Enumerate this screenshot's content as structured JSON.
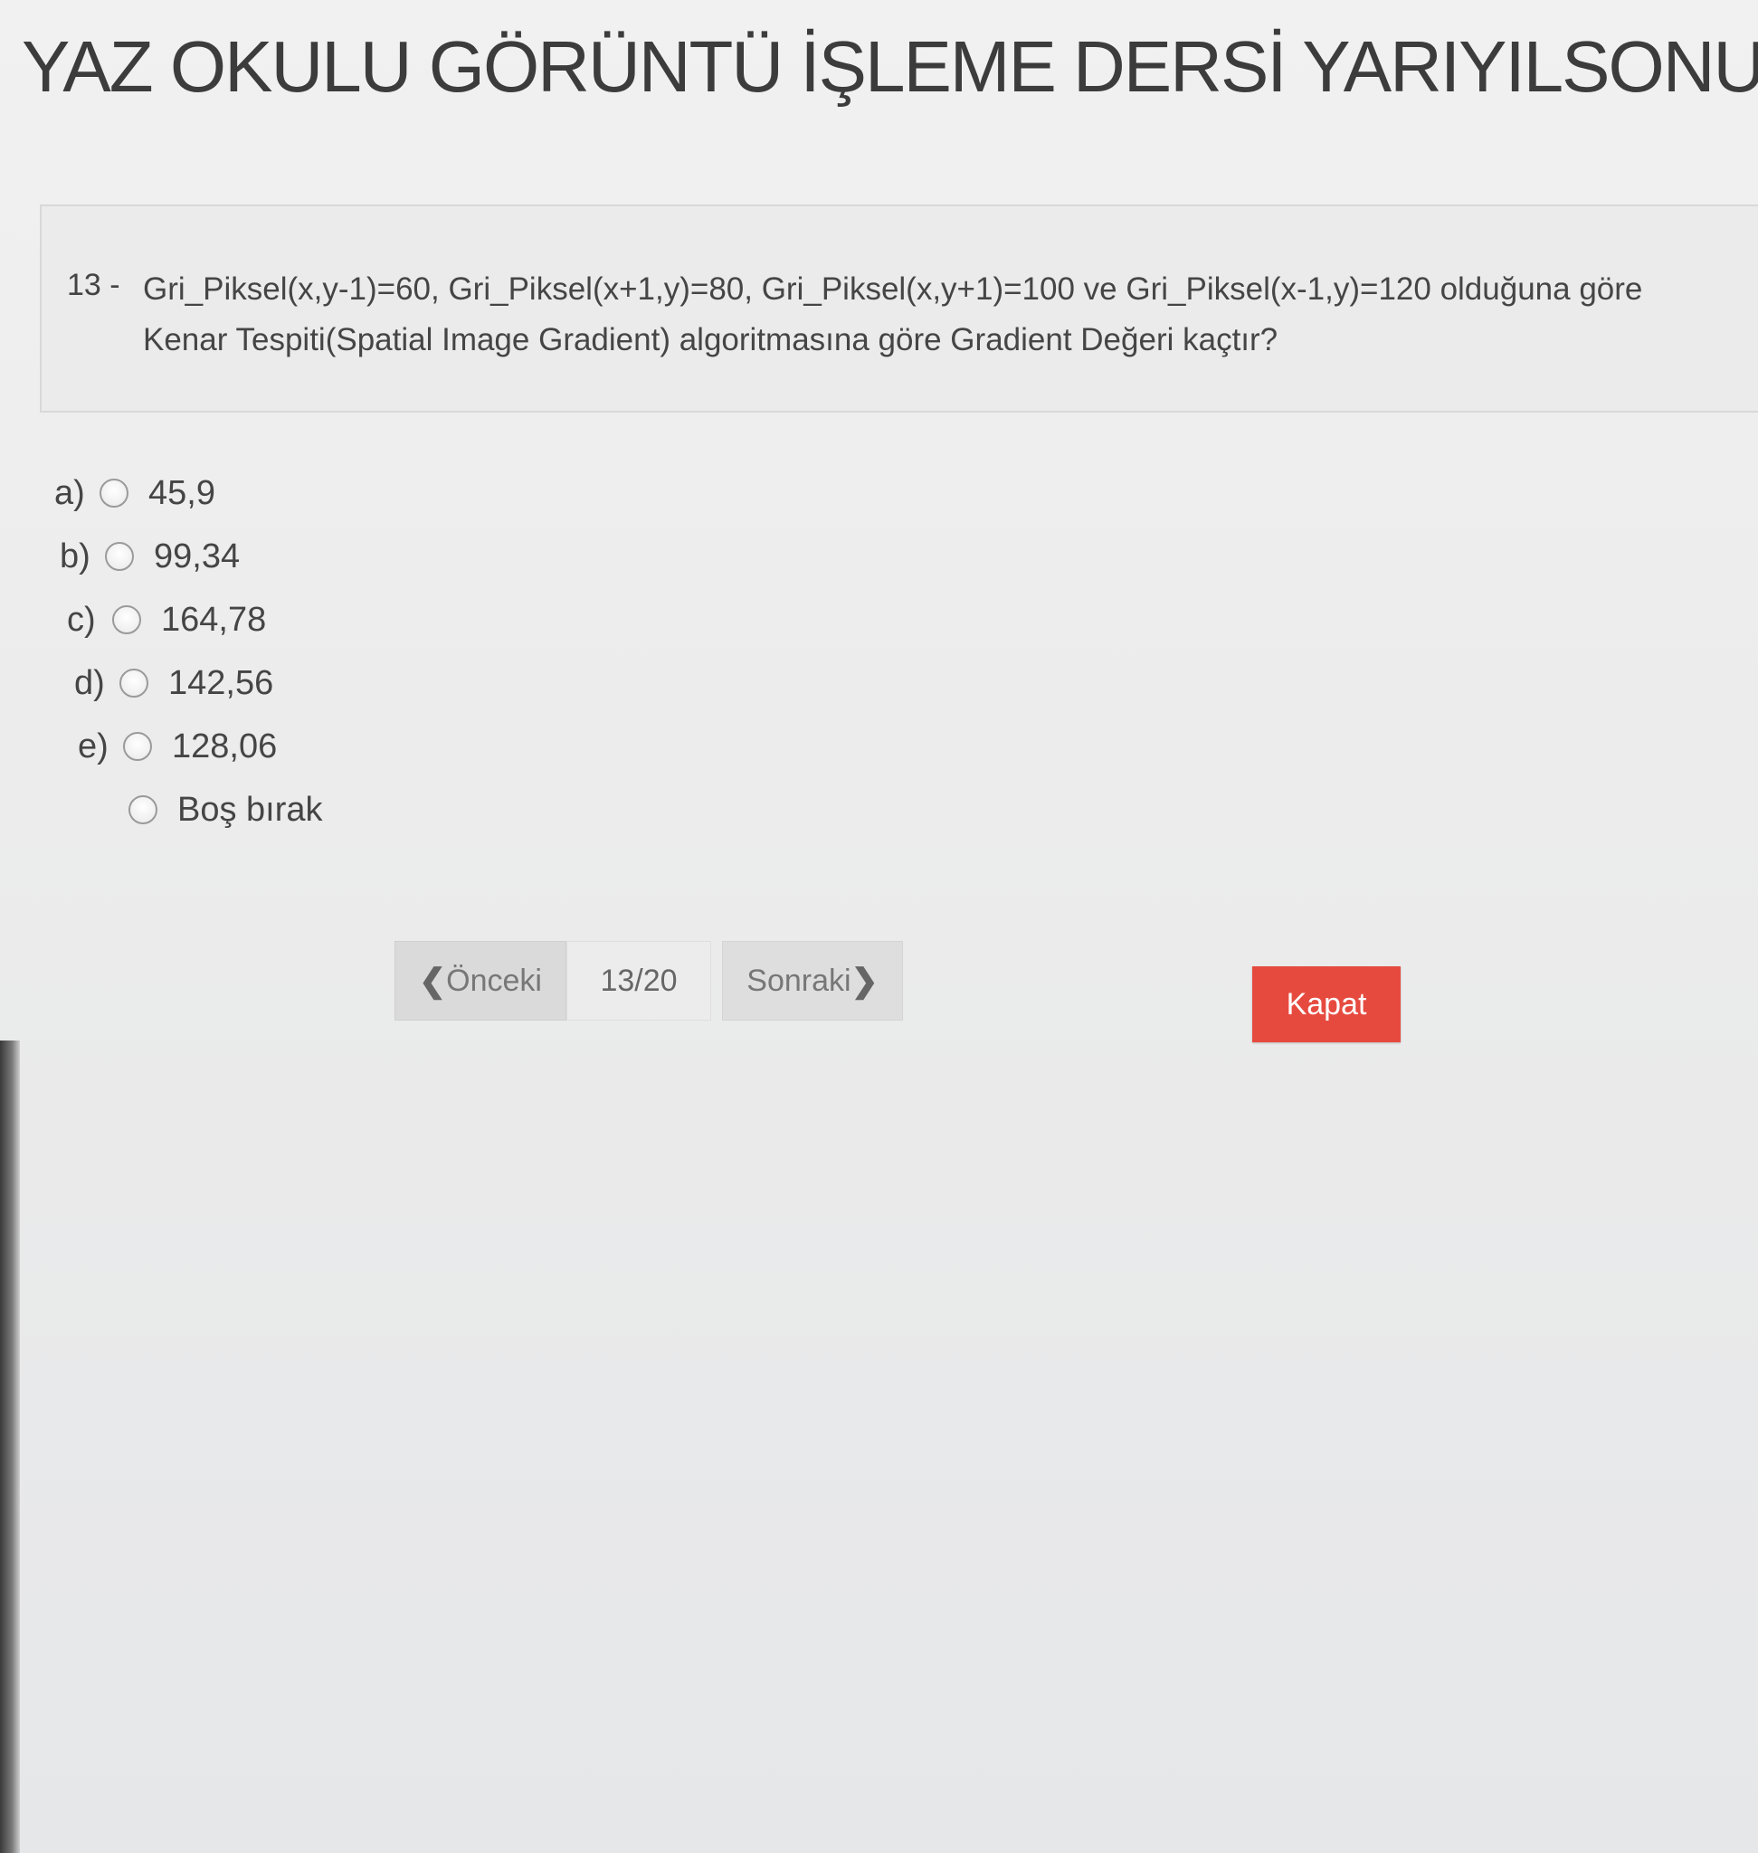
{
  "exam": {
    "title": "YAZ OKULU GÖRÜNTÜ İŞLEME DERSİ YARIYILSONU SINAVI(Final"
  },
  "question": {
    "number_label": "13 -",
    "text": "Gri_Piksel(x,y-1)=60, Gri_Piksel(x+1,y)=80, Gri_Piksel(x,y+1)=100 ve Gri_Piksel(x-1,y)=120 olduğuna göre Kenar Tespiti(Spatial Image Gradient) algoritmasına göre Gradient Değeri kaçtır?"
  },
  "options": [
    {
      "letter": "a)",
      "value": "45,9"
    },
    {
      "letter": "b)",
      "value": "99,34"
    },
    {
      "letter": "c)",
      "value": "164,78"
    },
    {
      "letter": "d)",
      "value": "142,56"
    },
    {
      "letter": "e)",
      "value": "128,06"
    },
    {
      "letter": "",
      "value": "Boş bırak"
    }
  ],
  "navigation": {
    "prev_label": "Önceki",
    "page_indicator": "13/20",
    "next_label": "Sonraki",
    "prev_icon": "chevron-left-icon",
    "next_icon": "chevron-right-icon"
  },
  "actions": {
    "close_label": "Kapat",
    "close_color": "#e64a3f"
  }
}
